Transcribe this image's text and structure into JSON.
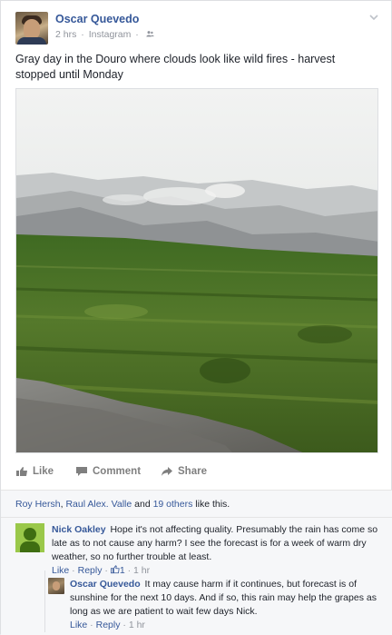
{
  "post": {
    "author": "Oscar Quevedo",
    "time": "2 hrs",
    "source": "Instagram",
    "status": "Gray day in the Douro where clouds look like wild fires - harvest stopped until Monday"
  },
  "actions": {
    "like": "Like",
    "comment": "Comment",
    "share": "Share"
  },
  "likes": {
    "person1": "Roy Hersh",
    "sep1": ", ",
    "person2": "Raul Alex. Valle",
    "and": " and ",
    "others": "19 others",
    "suffix": " like this."
  },
  "comments": [
    {
      "author": "Nick Oakley",
      "text": "Hope it's not affecting quality. Presumably the rain has come so late as to not cause any harm? I see the forecast is for a week of warm dry weather, so no further trouble at least.",
      "like": "Like",
      "reply": "Reply",
      "like_count": "1",
      "time": "1 hr"
    },
    {
      "author": "Oscar Quevedo",
      "text": "It may cause harm if it continues, but forecast is of sunshine for the next 10 days. And if so, this rain may help the grapes as long as we are patient to wait few days Nick.",
      "like": "Like",
      "reply": "Reply",
      "time": "1 hr"
    }
  ],
  "separators": {
    "dot": " · "
  },
  "colors": {
    "link": "#365899",
    "meta": "#90949c",
    "action": "#7f7f7f"
  }
}
